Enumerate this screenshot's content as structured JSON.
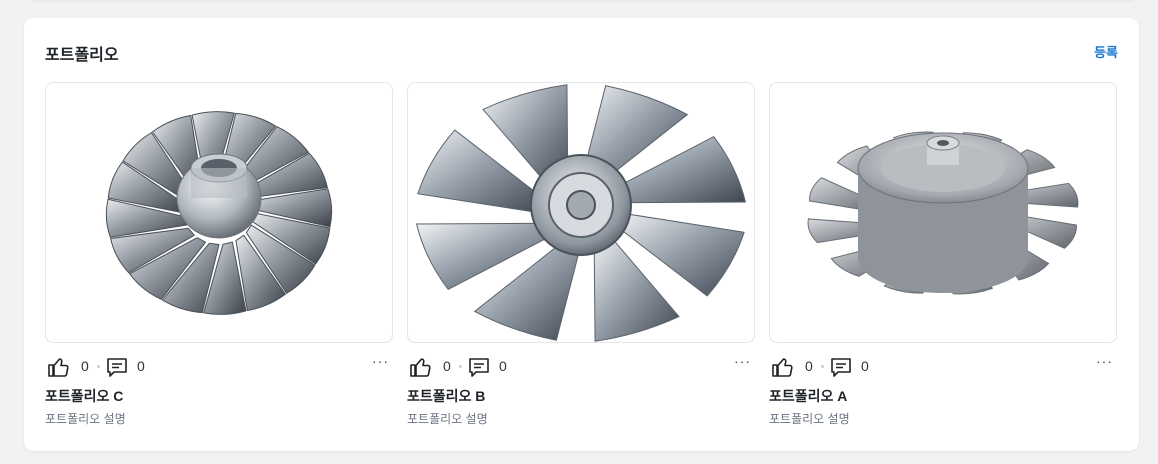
{
  "section": {
    "title": "포트폴리오",
    "register_label": "등록"
  },
  "portfolio": [
    {
      "title": "포트폴리오 C",
      "description": "포트폴리오 설명",
      "likes": "0",
      "comments": "0",
      "more": "···",
      "image": "impeller-c"
    },
    {
      "title": "포트폴리오 B",
      "description": "포트폴리오 설명",
      "likes": "0",
      "comments": "0",
      "more": "···",
      "image": "fan-b"
    },
    {
      "title": "포트폴리오 A",
      "description": "포트폴리오 설명",
      "likes": "0",
      "comments": "0",
      "more": "···",
      "image": "impeller-a"
    }
  ],
  "icons": {
    "like": "thumbs-up-icon",
    "comment": "comment-icon",
    "more": "more-icon"
  },
  "colors": {
    "accent": "#1976d2",
    "border": "#e3e5e8",
    "muted": "#6b7280"
  }
}
